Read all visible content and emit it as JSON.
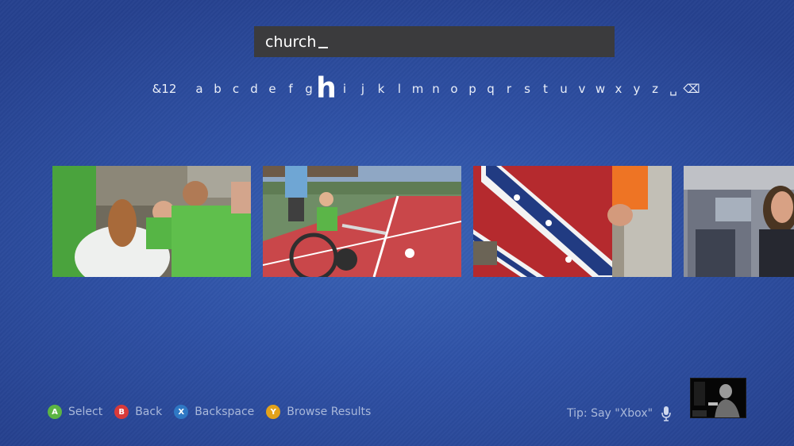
{
  "search": {
    "query": "church"
  },
  "keyboard": {
    "keys": [
      "&12",
      "a",
      "b",
      "c",
      "d",
      "e",
      "f",
      "g",
      "h",
      "i",
      "j",
      "k",
      "l",
      "m",
      "n",
      "o",
      "p",
      "q",
      "r",
      "s",
      "t",
      "u",
      "v",
      "w",
      "x",
      "y",
      "z",
      "␣",
      "⌫"
    ],
    "selected": "h"
  },
  "results": [
    {
      "icon": "green-shirts-group-thumbnail"
    },
    {
      "icon": "wheelchair-baseball-thumbnail"
    },
    {
      "icon": "confederate-flag-thumbnail"
    },
    {
      "icon": "woman-office-thumbnail"
    }
  ],
  "legend": {
    "a": {
      "glyph": "A",
      "label": "Select",
      "color": "#5cb543"
    },
    "b": {
      "glyph": "B",
      "label": "Back",
      "color": "#d83a3a"
    },
    "x": {
      "glyph": "X",
      "label": "Backspace",
      "color": "#2f78c4"
    },
    "y": {
      "glyph": "Y",
      "label": "Browse Results",
      "color": "#e2a21b"
    }
  },
  "tip": {
    "text": "Tip: Say \"Xbox\"",
    "icon": "microphone-icon"
  },
  "kinect": {
    "icon": "kinect-camera-preview"
  }
}
